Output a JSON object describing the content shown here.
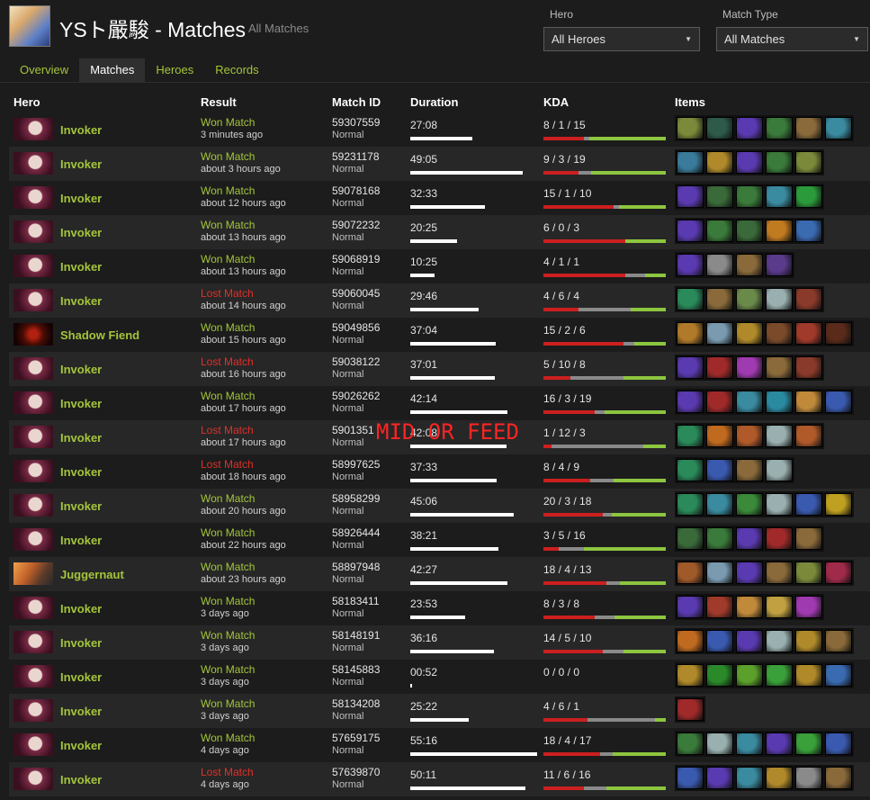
{
  "profile": {
    "title": "YSト嚴駿 - Matches",
    "subtitle": "All Matches"
  },
  "filters": {
    "hero": {
      "label": "Hero",
      "value": "All Heroes"
    },
    "match_type": {
      "label": "Match Type",
      "value": "All Matches"
    }
  },
  "tabs": [
    {
      "label": "Overview",
      "active": false
    },
    {
      "label": "Matches",
      "active": true
    },
    {
      "label": "Heroes",
      "active": false
    },
    {
      "label": "Records",
      "active": false
    }
  ],
  "table": {
    "headers": {
      "hero": "Hero",
      "result": "Result",
      "match_id": "Match ID",
      "duration": "Duration",
      "kda": "KDA",
      "items": "Items"
    }
  },
  "overlay_text": "MID OR FEED",
  "colors": {
    "accent_green": "#a3c53a",
    "loss_red": "#e0302a",
    "kill_red": "#cc1f1f",
    "death_gray": "#8a8a8a",
    "assist_green": "#8dc63f"
  },
  "matches": [
    {
      "hero": "Invoker",
      "portrait": "invoker-portrait",
      "result": "Won Match",
      "won": true,
      "ago": "3 minutes ago",
      "match_id": "59307559",
      "type": "Normal",
      "duration": "27:08",
      "k": 8,
      "d": 1,
      "a": 15,
      "kda": "8 / 1 / 15",
      "items": [
        "#7a8a3a",
        "#2e5a4a",
        "#5a3ab0",
        "#3a7a3a",
        "#8a6a3a",
        "#3a8aa0"
      ]
    },
    {
      "hero": "Invoker",
      "portrait": "invoker-portrait",
      "result": "Won Match",
      "won": true,
      "ago": "about 3 hours ago",
      "match_id": "59231178",
      "type": "Normal",
      "duration": "49:05",
      "k": 9,
      "d": 3,
      "a": 19,
      "kda": "9 / 3 / 19",
      "items": [
        "#3a7a9a",
        "#b08a2a",
        "#5a3ab0",
        "#3a7a3a",
        "#7a8a3a"
      ]
    },
    {
      "hero": "Invoker",
      "portrait": "invoker-portrait",
      "result": "Won Match",
      "won": true,
      "ago": "about 12 hours ago",
      "match_id": "59078168",
      "type": "Normal",
      "duration": "32:33",
      "k": 15,
      "d": 1,
      "a": 10,
      "kda": "15 / 1 / 10",
      "items": [
        "#5a3ab0",
        "#3a6a3a",
        "#3a7a3a",
        "#3a8aa0",
        "#2a9a3a"
      ]
    },
    {
      "hero": "Invoker",
      "portrait": "invoker-portrait",
      "result": "Won Match",
      "won": true,
      "ago": "about 13 hours ago",
      "match_id": "59072232",
      "type": "Normal",
      "duration": "20:25",
      "k": 6,
      "d": 0,
      "a": 3,
      "kda": "6 / 0 / 3",
      "items": [
        "#5a3ab0",
        "#3a7a3a",
        "#3a6a3a",
        "#c07a20",
        "#3a6ab0"
      ]
    },
    {
      "hero": "Invoker",
      "portrait": "invoker-portrait",
      "result": "Won Match",
      "won": true,
      "ago": "about 13 hours ago",
      "match_id": "59068919",
      "type": "Normal",
      "duration": "10:25",
      "k": 4,
      "d": 1,
      "a": 1,
      "kda": "4 / 1 / 1",
      "items": [
        "#5a3ab0",
        "#8a8a8a",
        "#8a6a3a",
        "#5a3a8a"
      ]
    },
    {
      "hero": "Invoker",
      "portrait": "invoker-portrait",
      "result": "Lost Match",
      "won": false,
      "ago": "about 14 hours ago",
      "match_id": "59060045",
      "type": "Normal",
      "duration": "29:46",
      "k": 4,
      "d": 6,
      "a": 4,
      "kda": "4 / 6 / 4",
      "items": [
        "#2a8a5a",
        "#8a6a3a",
        "#6a8a4a",
        "#9ab0b0",
        "#8a3a2a"
      ]
    },
    {
      "hero": "Shadow Fiend",
      "portrait": "shadow-fiend-portrait",
      "result": "Won Match",
      "won": true,
      "ago": "about 15 hours ago",
      "match_id": "59049856",
      "type": "Normal",
      "duration": "37:04",
      "k": 15,
      "d": 2,
      "a": 6,
      "kda": "15 / 2 / 6",
      "items": [
        "#b07a2a",
        "#7a9ab0",
        "#b08a2a",
        "#7a4a2a",
        "#a03a2a",
        "#5a2a1a"
      ]
    },
    {
      "hero": "Invoker",
      "portrait": "invoker-portrait",
      "result": "Lost Match",
      "won": false,
      "ago": "about 16 hours ago",
      "match_id": "59038122",
      "type": "Normal",
      "duration": "37:01",
      "k": 5,
      "d": 10,
      "a": 8,
      "kda": "5 / 10 / 8",
      "items": [
        "#5a3ab0",
        "#a02a2a",
        "#a03ab0",
        "#8a6a3a",
        "#8a3a2a"
      ]
    },
    {
      "hero": "Invoker",
      "portrait": "invoker-portrait",
      "result": "Won Match",
      "won": true,
      "ago": "about 17 hours ago",
      "match_id": "59026262",
      "type": "Normal",
      "duration": "42:14",
      "k": 16,
      "d": 3,
      "a": 19,
      "kda": "16 / 3 / 19",
      "items": [
        "#5a3ab0",
        "#a02a2a",
        "#3a8aa0",
        "#2a8aa0",
        "#c08a3a",
        "#3a5ab0"
      ]
    },
    {
      "hero": "Invoker",
      "portrait": "invoker-portrait",
      "result": "Lost Match",
      "won": false,
      "ago": "about 17 hours ago",
      "match_id": "5901351",
      "type": "Normal",
      "duration": "42:08",
      "k": 1,
      "d": 12,
      "a": 3,
      "kda": "1 / 12 / 3",
      "items": [
        "#2a8a5a",
        "#c06a20",
        "#b05a2a",
        "#9ab0b0",
        "#b05a2a"
      ]
    },
    {
      "hero": "Invoker",
      "portrait": "invoker-portrait",
      "result": "Lost Match",
      "won": false,
      "ago": "about 18 hours ago",
      "match_id": "58997625",
      "type": "Normal",
      "duration": "37:33",
      "k": 8,
      "d": 4,
      "a": 9,
      "kda": "8 / 4 / 9",
      "items": [
        "#2a8a5a",
        "#3a5ab0",
        "#8a6a3a",
        "#9ab0b0"
      ]
    },
    {
      "hero": "Invoker",
      "portrait": "invoker-portrait",
      "result": "Won Match",
      "won": true,
      "ago": "about 20 hours ago",
      "match_id": "58958299",
      "type": "Normal",
      "duration": "45:06",
      "k": 20,
      "d": 3,
      "a": 18,
      "kda": "20 / 3 / 18",
      "items": [
        "#2a8a5a",
        "#3a8aa0",
        "#3a8a3a",
        "#9ab0b0",
        "#3a5ab0",
        "#c0a020"
      ]
    },
    {
      "hero": "Invoker",
      "portrait": "invoker-portrait",
      "result": "Won Match",
      "won": true,
      "ago": "about 22 hours ago",
      "match_id": "58926444",
      "type": "Normal",
      "duration": "38:21",
      "k": 3,
      "d": 5,
      "a": 16,
      "kda": "3 / 5 / 16",
      "items": [
        "#3a6a3a",
        "#3a7a3a",
        "#5a3ab0",
        "#a02a2a",
        "#8a6a3a"
      ]
    },
    {
      "hero": "Juggernaut",
      "portrait": "juggernaut-portrait",
      "result": "Won Match",
      "won": true,
      "ago": "about 23 hours ago",
      "match_id": "58897948",
      "type": "Normal",
      "duration": "42:27",
      "k": 18,
      "d": 4,
      "a": 13,
      "kda": "18 / 4 / 13",
      "items": [
        "#a05a2a",
        "#7a9ab0",
        "#5a3ab0",
        "#8a6a3a",
        "#7a8a3a",
        "#a02a4a"
      ]
    },
    {
      "hero": "Invoker",
      "portrait": "invoker-portrait",
      "result": "Won Match",
      "won": true,
      "ago": "3 days ago",
      "match_id": "58183411",
      "type": "Normal",
      "duration": "23:53",
      "k": 8,
      "d": 3,
      "a": 8,
      "kda": "8 / 3 / 8",
      "items": [
        "#5a3ab0",
        "#a03a2a",
        "#c08a3a",
        "#c0a040",
        "#a03ab0"
      ]
    },
    {
      "hero": "Invoker",
      "portrait": "invoker-portrait",
      "result": "Won Match",
      "won": true,
      "ago": "3 days ago",
      "match_id": "58148191",
      "type": "Normal",
      "duration": "36:16",
      "k": 14,
      "d": 5,
      "a": 10,
      "kda": "14 / 5 / 10",
      "items": [
        "#c06a20",
        "#3a5ab0",
        "#5a3ab0",
        "#9ab0b0",
        "#b08a2a",
        "#8a6a3a"
      ]
    },
    {
      "hero": "Invoker",
      "portrait": "invoker-portrait",
      "result": "Won Match",
      "won": true,
      "ago": "3 days ago",
      "match_id": "58145883",
      "type": "Normal",
      "duration": "00:52",
      "k": 0,
      "d": 0,
      "a": 0,
      "kda": "0 / 0 / 0",
      "items": [
        "#b08a2a",
        "#2a8a2a",
        "#5aa02a",
        "#3aa03a",
        "#b08a2a",
        "#3a6ab0"
      ]
    },
    {
      "hero": "Invoker",
      "portrait": "invoker-portrait",
      "result": "Won Match",
      "won": true,
      "ago": "3 days ago",
      "match_id": "58134208",
      "type": "Normal",
      "duration": "25:22",
      "k": 4,
      "d": 6,
      "a": 1,
      "kda": "4 / 6 / 1",
      "items": [
        "#a02a2a"
      ]
    },
    {
      "hero": "Invoker",
      "portrait": "invoker-portrait",
      "result": "Won Match",
      "won": true,
      "ago": "4 days ago",
      "match_id": "57659175",
      "type": "Normal",
      "duration": "55:16",
      "k": 18,
      "d": 4,
      "a": 17,
      "kda": "18 / 4 / 17",
      "items": [
        "#3a7a3a",
        "#9ab0b0",
        "#3a8aa0",
        "#5a3ab0",
        "#3aa03a",
        "#3a5ab0"
      ]
    },
    {
      "hero": "Invoker",
      "portrait": "invoker-portrait",
      "result": "Lost Match",
      "won": false,
      "ago": "4 days ago",
      "match_id": "57639870",
      "type": "Normal",
      "duration": "50:11",
      "k": 11,
      "d": 6,
      "a": 16,
      "kda": "11 / 6 / 16",
      "items": [
        "#3a5ab0",
        "#5a3ab0",
        "#3a8aa0",
        "#b08a2a",
        "#8a8a8a",
        "#8a6a3a"
      ]
    }
  ]
}
